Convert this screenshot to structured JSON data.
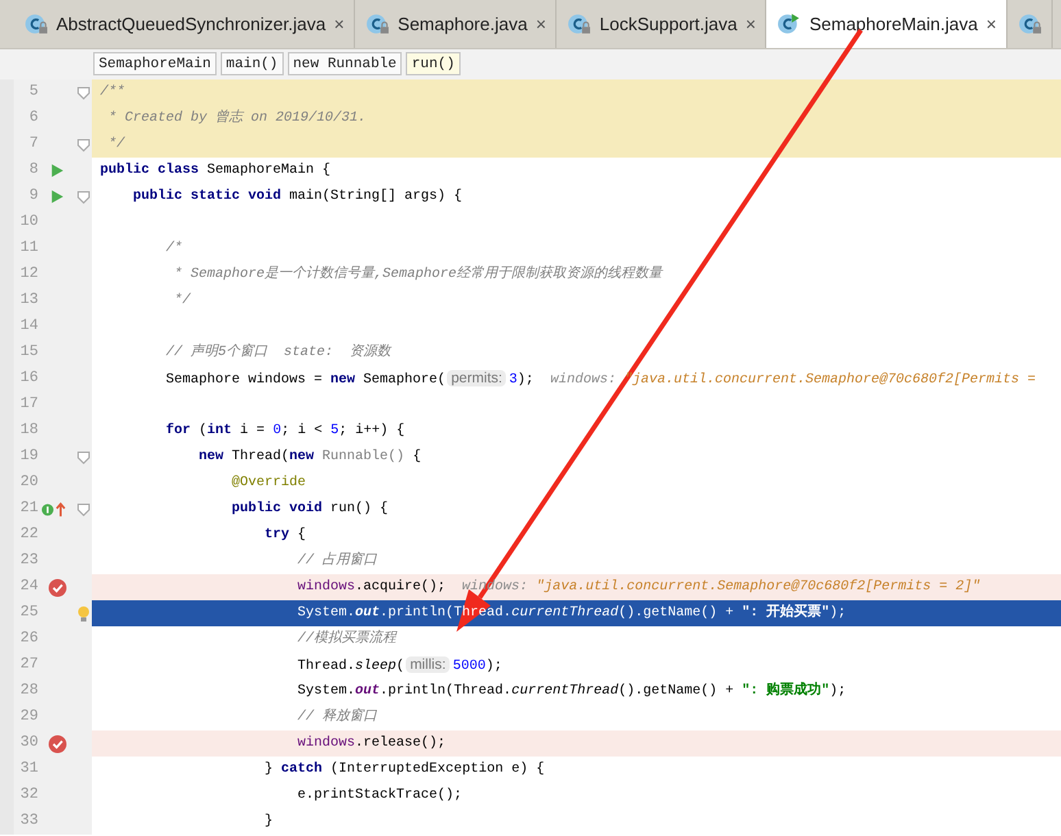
{
  "tabs": [
    {
      "kind": "locked",
      "label": "AbstractQueuedSynchronizer.java",
      "selected": false,
      "close": "×"
    },
    {
      "kind": "locked",
      "label": "Semaphore.java",
      "selected": false,
      "close": "×"
    },
    {
      "kind": "locked",
      "label": "LockSupport.java",
      "selected": false,
      "close": "×"
    },
    {
      "kind": "runnable",
      "label": "SemaphoreMain.java",
      "selected": true,
      "close": "×"
    },
    {
      "kind": "locked",
      "selected": false
    }
  ],
  "breadcrumbs": [
    {
      "label": "SemaphoreMain",
      "selected": false
    },
    {
      "label": "main()",
      "selected": false
    },
    {
      "label": "new Runnable",
      "selected": false
    },
    {
      "label": "run()",
      "selected": true
    }
  ],
  "lines": [
    {
      "number": "5",
      "kind": "doc",
      "fold": true,
      "tokens": [
        {
          "kind": "doc",
          "text": "/**"
        }
      ]
    },
    {
      "number": "6",
      "kind": "doc",
      "tokens": [
        {
          "kind": "doc",
          "text": " * Created by 曾志 on 2019/10/31."
        }
      ]
    },
    {
      "number": "7",
      "kind": "doc",
      "fold": true,
      "tokens": [
        {
          "kind": "doc",
          "text": " */"
        }
      ]
    },
    {
      "number": "8",
      "kind": "code",
      "run": true,
      "tokens": [
        {
          "kind": "keyword",
          "text": "public class "
        },
        {
          "kind": "plain",
          "text": "SemaphoreMain {"
        }
      ]
    },
    {
      "number": "9",
      "kind": "code",
      "run": true,
      "fold": true,
      "tokens": [
        {
          "kind": "keyword",
          "text": "    public static void "
        },
        {
          "kind": "plain",
          "text": "main(String[] args) {"
        }
      ]
    },
    {
      "number": "10",
      "kind": "code"
    },
    {
      "number": "11",
      "kind": "code",
      "tokens": [
        {
          "kind": "comment",
          "text": "        /*"
        }
      ]
    },
    {
      "number": "12",
      "kind": "code",
      "tokens": [
        {
          "kind": "comment",
          "text": "         * Semaphore是一个计数信号量,Semaphore经常用于限制获取资源的线程数量"
        }
      ]
    },
    {
      "number": "13",
      "kind": "code",
      "tokens": [
        {
          "kind": "comment",
          "text": "         */"
        }
      ]
    },
    {
      "number": "14",
      "kind": "code"
    },
    {
      "number": "15",
      "kind": "code",
      "tokens": [
        {
          "kind": "comment",
          "text": "        // 声明5个窗口  state:  资源数"
        }
      ]
    },
    {
      "number": "16",
      "kind": "code",
      "tokens": [
        {
          "kind": "plain",
          "text": "        Semaphore windows = "
        },
        {
          "kind": "keyword",
          "text": "new "
        },
        {
          "kind": "plain",
          "text": "Semaphore("
        },
        {
          "kind": "hint",
          "text": "permits:"
        },
        {
          "kind": "number",
          "text": "3"
        },
        {
          "kind": "plain",
          "text": ");  "
        },
        {
          "kind": "debuglabel",
          "text": "windows: "
        },
        {
          "kind": "debugvalue",
          "text": "\"java.util.concurrent.Semaphore@70c680f2[Permits ="
        }
      ]
    },
    {
      "number": "17",
      "kind": "code"
    },
    {
      "number": "18",
      "kind": "code",
      "tokens": [
        {
          "kind": "keyword",
          "text": "        for "
        },
        {
          "kind": "plain",
          "text": "("
        },
        {
          "kind": "keyword",
          "text": "int "
        },
        {
          "kind": "plain",
          "text": "i = "
        },
        {
          "kind": "number",
          "text": "0"
        },
        {
          "kind": "plain",
          "text": "; i < "
        },
        {
          "kind": "number",
          "text": "5"
        },
        {
          "kind": "plain",
          "text": "; i++) {"
        }
      ]
    },
    {
      "number": "19",
      "kind": "code",
      "fold": true,
      "tokens": [
        {
          "kind": "keyword",
          "text": "            new "
        },
        {
          "kind": "plain",
          "text": "Thread("
        },
        {
          "kind": "keyword",
          "text": "new "
        },
        {
          "kind": "unused",
          "text": "Runnable()"
        },
        {
          "kind": "plain",
          "text": " {"
        }
      ]
    },
    {
      "number": "20",
      "kind": "code",
      "tokens": [
        {
          "kind": "annotation",
          "text": "                @Override"
        }
      ]
    },
    {
      "number": "21",
      "kind": "code",
      "override": true,
      "fold": true,
      "tokens": [
        {
          "kind": "keyword",
          "text": "                public void "
        },
        {
          "kind": "plain",
          "text": "run() {"
        }
      ]
    },
    {
      "number": "22",
      "kind": "code",
      "tokens": [
        {
          "kind": "keyword",
          "text": "                    try "
        },
        {
          "kind": "plain",
          "text": "{"
        }
      ]
    },
    {
      "number": "23",
      "kind": "code",
      "tokens": [
        {
          "kind": "comment",
          "text": "                        // 占用窗口"
        }
      ]
    },
    {
      "number": "24",
      "kind": "breakpoint",
      "tokens": [
        {
          "kind": "field",
          "text": "                        windows"
        },
        {
          "kind": "plain",
          "text": ".acquire();  "
        },
        {
          "kind": "debuglabel",
          "text": "windows: "
        },
        {
          "kind": "debugvalue",
          "text": "\"java.util.concurrent.Semaphore@70c680f2[Permits = 2]\""
        }
      ]
    },
    {
      "number": "25",
      "kind": "current",
      "bulb": true,
      "tokens": [
        {
          "kind": "plain",
          "text": "                        System."
        },
        {
          "kind": "static",
          "text": "out"
        },
        {
          "kind": "plain",
          "text": ".println(Thread."
        },
        {
          "kind": "italic",
          "text": "currentThread"
        },
        {
          "kind": "plain",
          "text": "().getName() + "
        },
        {
          "kind": "string",
          "text": "\": 开始买票\""
        },
        {
          "kind": "plain",
          "text": ");"
        }
      ]
    },
    {
      "number": "26",
      "kind": "code",
      "tokens": [
        {
          "kind": "comment",
          "text": "                        //模拟买票流程"
        }
      ]
    },
    {
      "number": "27",
      "kind": "code",
      "tokens": [
        {
          "kind": "plain",
          "text": "                        Thread."
        },
        {
          "kind": "italic",
          "text": "sleep"
        },
        {
          "kind": "plain",
          "text": "("
        },
        {
          "kind": "hint",
          "text": "millis:"
        },
        {
          "kind": "number",
          "text": "5000"
        },
        {
          "kind": "plain",
          "text": ");"
        }
      ]
    },
    {
      "number": "28",
      "kind": "code",
      "tokens": [
        {
          "kind": "plain",
          "text": "                        System."
        },
        {
          "kind": "static",
          "text": "out"
        },
        {
          "kind": "plain",
          "text": ".println(Thread."
        },
        {
          "kind": "italic",
          "text": "currentThread"
        },
        {
          "kind": "plain",
          "text": "().getName() + "
        },
        {
          "kind": "string",
          "text": "\": 购票成功\""
        },
        {
          "kind": "plain",
          "text": ");"
        }
      ]
    },
    {
      "number": "29",
      "kind": "code",
      "tokens": [
        {
          "kind": "comment",
          "text": "                        // 释放窗口"
        }
      ]
    },
    {
      "number": "30",
      "kind": "breakpoint",
      "tokens": [
        {
          "kind": "field",
          "text": "                        windows"
        },
        {
          "kind": "plain",
          "text": ".release();"
        }
      ]
    },
    {
      "number": "31",
      "kind": "code",
      "tokens": [
        {
          "kind": "plain",
          "text": "                    } "
        },
        {
          "kind": "keyword",
          "text": "catch "
        },
        {
          "kind": "plain",
          "text": "(InterruptedException e) {"
        }
      ]
    },
    {
      "number": "32",
      "kind": "code",
      "tokens": [
        {
          "kind": "plain",
          "text": "                        e.printStackTrace();"
        }
      ]
    },
    {
      "number": "33",
      "kind": "code",
      "tokens": [
        {
          "kind": "plain",
          "text": "                    }"
        }
      ]
    }
  ],
  "annotation": {
    "kind": "arrow"
  }
}
